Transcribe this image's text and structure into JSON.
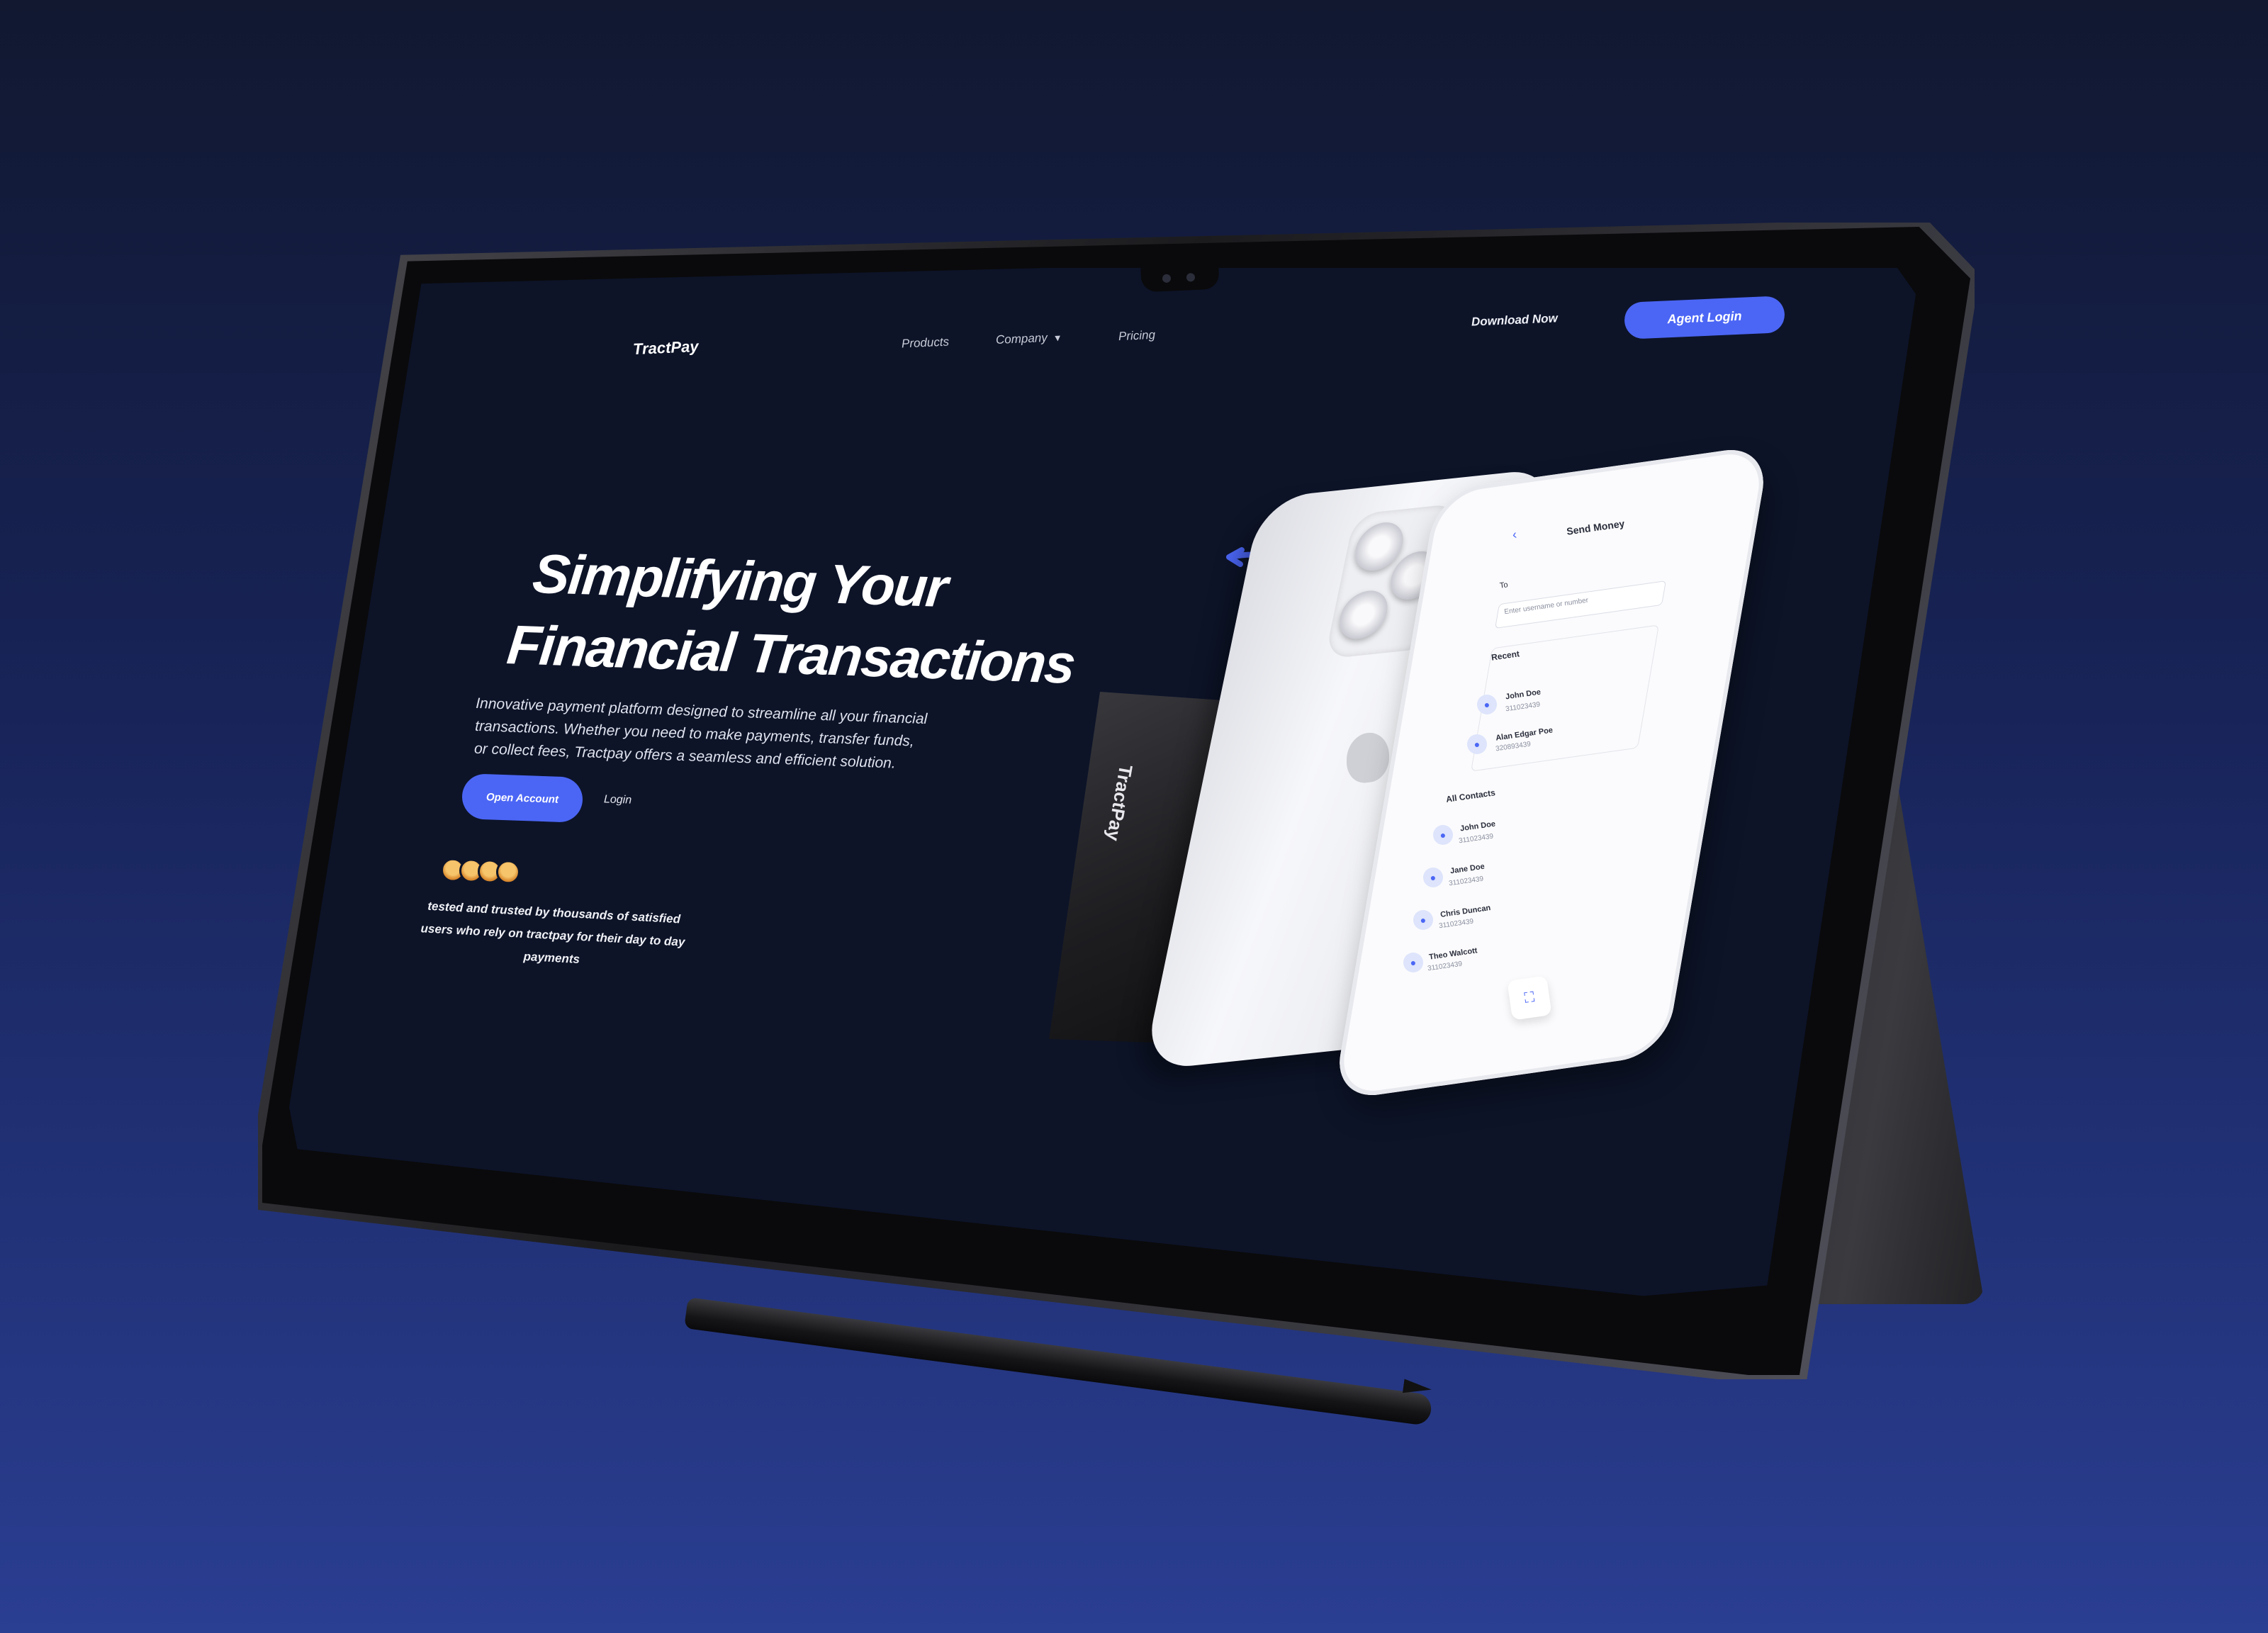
{
  "app": {
    "brand": "TractPay"
  },
  "nav": {
    "items": [
      "Products",
      "Company",
      "Pricing"
    ],
    "download_label": "Download Now",
    "agent_login_label": "Agent Login"
  },
  "hero": {
    "title_line1": "Simplifying Your",
    "title_line2": "Financial Transactions",
    "description": "Innovative payment platform designed to streamline all your financial transactions. Whether you need to make payments, transfer funds, or collect fees, Tractpay offers a seamless and efficient solution.",
    "open_account_label": "Open Account",
    "login_label": "Login",
    "trusted_text": "tested and trusted by thousands of satisfied users who rely on tractpay for their day to day payments"
  },
  "card": {
    "brand": "TractPay"
  },
  "phone": {
    "header": "Send Money",
    "to_label": "To",
    "to_placeholder": "Enter username or number",
    "recent_label": "Recent",
    "recent": [
      {
        "name": "John Doe",
        "number": "311023439"
      },
      {
        "name": "Alan Edgar Poe",
        "number": "320893439"
      }
    ],
    "all_contacts_label": "All Contacts",
    "contacts": [
      {
        "name": "John Doe",
        "number": "311023439"
      },
      {
        "name": "Jane Doe",
        "number": "311023439"
      },
      {
        "name": "Chris Duncan",
        "number": "311023439"
      },
      {
        "name": "Theo Walcott",
        "number": "311023439"
      }
    ]
  },
  "colors": {
    "accent": "#4b66f5",
    "screen_bg": "#0d1428"
  }
}
